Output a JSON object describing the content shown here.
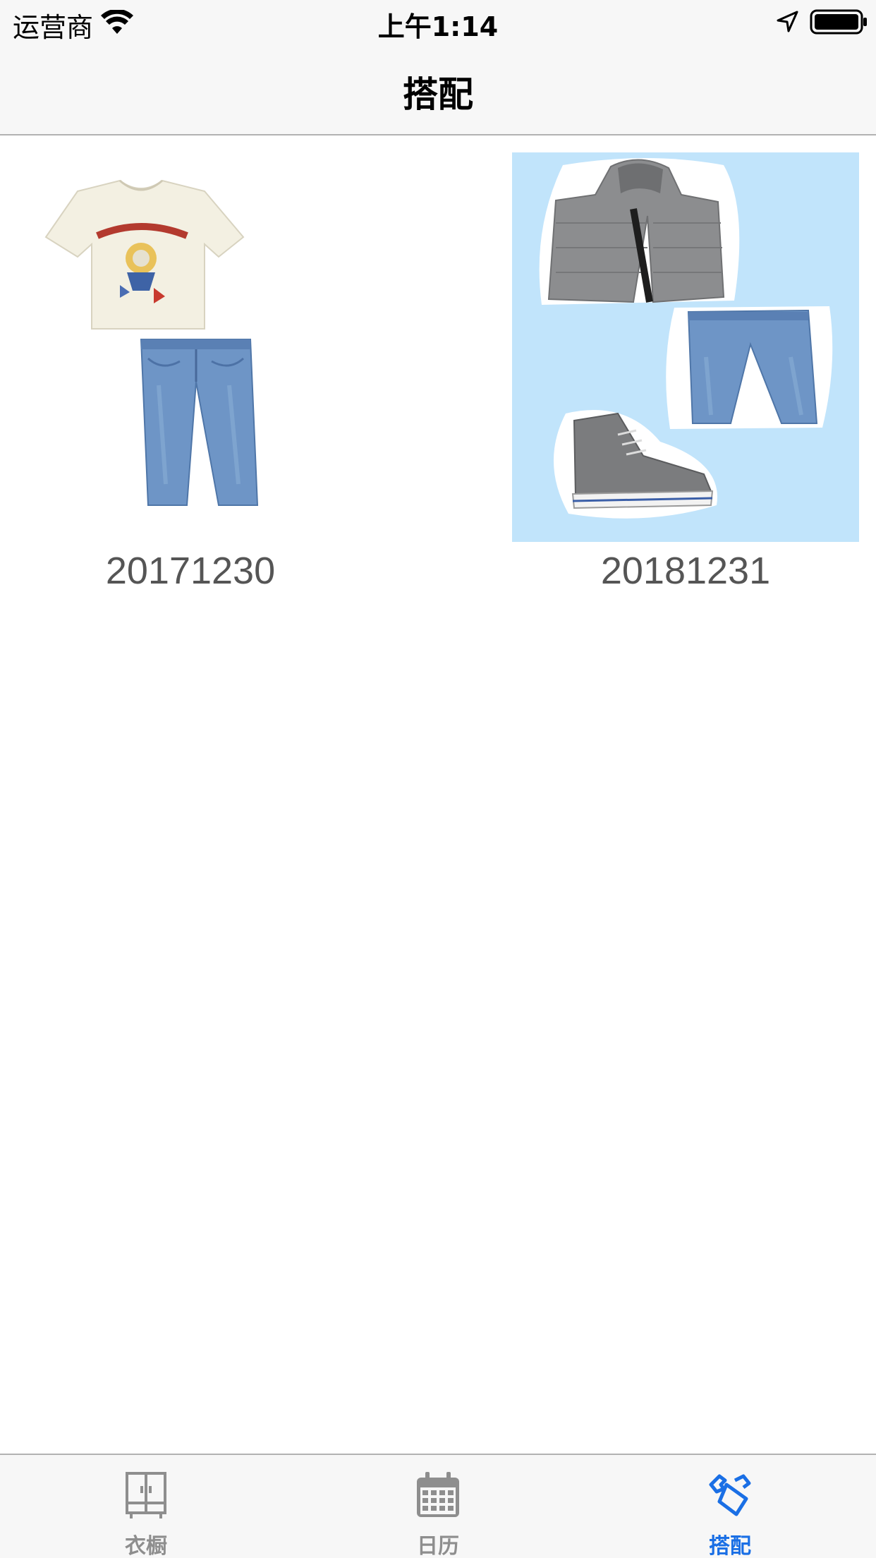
{
  "status_bar": {
    "carrier": "运营商",
    "time": "上午1:14"
  },
  "nav": {
    "title": "搭配"
  },
  "outfits": [
    {
      "date": "20171230",
      "items": [
        "t-shirt",
        "jeans"
      ],
      "background": "#ffffff"
    },
    {
      "date": "20181231",
      "items": [
        "puffer-jacket",
        "jeans",
        "sneaker"
      ],
      "background": "#c1e4fb"
    }
  ],
  "tabs": [
    {
      "label": "衣橱",
      "icon": "wardrobe-icon",
      "active": false
    },
    {
      "label": "日历",
      "icon": "calendar-icon",
      "active": false
    },
    {
      "label": "搭配",
      "icon": "outfit-icon",
      "active": true
    }
  ],
  "colors": {
    "accent": "#1a6fe5",
    "inactive": "#8e8e8e",
    "bar_background": "#f7f7f7"
  }
}
